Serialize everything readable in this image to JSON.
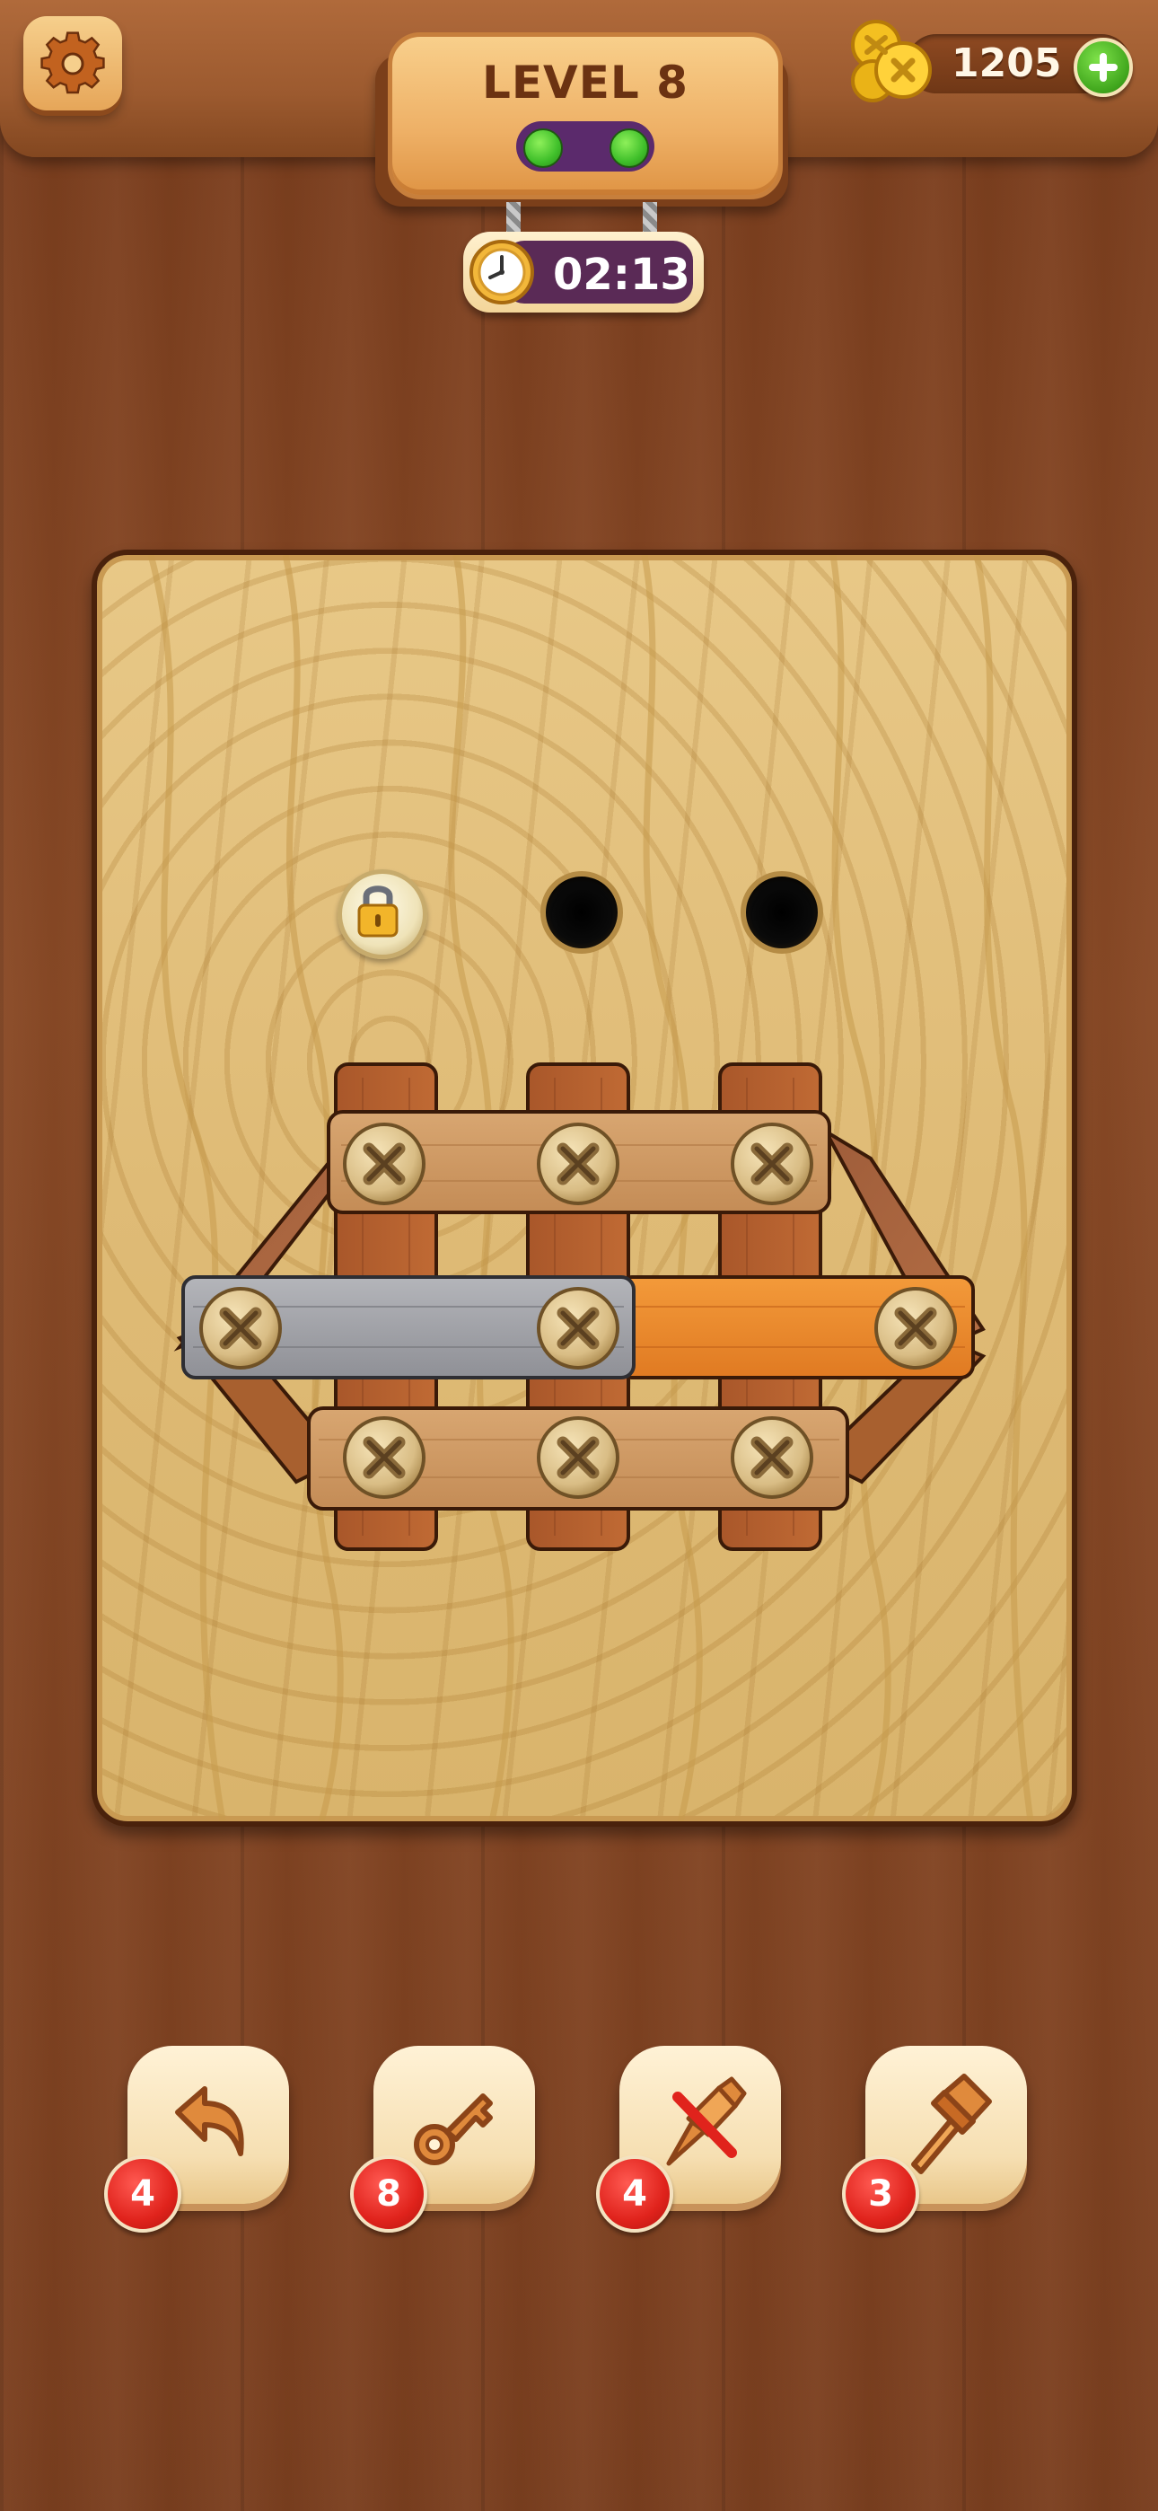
{
  "header": {
    "level_label": "LEVEL 8",
    "level_progress_filled": 2,
    "level_progress_total": 2,
    "coins": "1205",
    "timer": "02:13"
  },
  "board": {
    "locked_slot": "padlock-icon",
    "empty_holes": 2,
    "screws_remaining": 10
  },
  "tools": [
    {
      "name": "undo",
      "icon": "undo-arrow-icon",
      "count": "4"
    },
    {
      "name": "key",
      "icon": "key-icon",
      "count": "8"
    },
    {
      "name": "drill",
      "icon": "drill-icon",
      "count": "4"
    },
    {
      "name": "hammer",
      "icon": "hammer-icon",
      "count": "3"
    }
  ],
  "colors": {
    "accent_green": "#3fbf2a",
    "badge_red": "#e0231c",
    "wood_board": "#dfbb76",
    "plank_orange": "#e8832e",
    "plank_gray": "#9c9ca0"
  }
}
